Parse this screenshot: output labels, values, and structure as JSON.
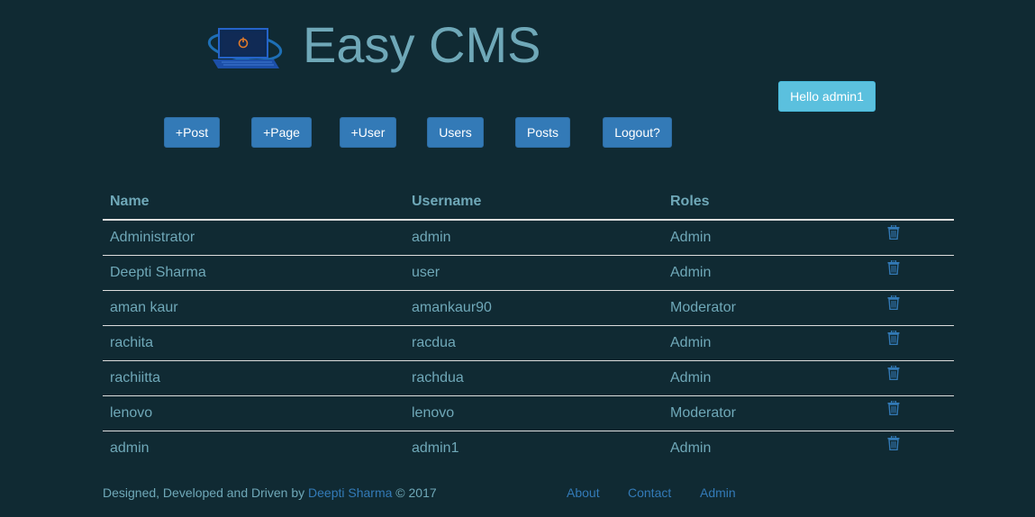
{
  "header": {
    "logo_icon": "laptop-power-icon",
    "title": "Easy CMS",
    "greeting": "Hello admin1"
  },
  "nav": {
    "post": "+Post",
    "page": "+Page",
    "user": "+User",
    "users": "Users",
    "posts": "Posts",
    "logout": "Logout?"
  },
  "table": {
    "headers": [
      "Name",
      "Username",
      "Roles"
    ],
    "rows": [
      {
        "name": "Administrator",
        "username": "admin",
        "role": "Admin"
      },
      {
        "name": "Deepti Sharma",
        "username": "user",
        "role": "Admin"
      },
      {
        "name": "aman kaur",
        "username": "amankaur90",
        "role": "Moderator"
      },
      {
        "name": "rachita",
        "username": "racdua",
        "role": "Admin"
      },
      {
        "name": "rachiitta",
        "username": "rachdua",
        "role": "Admin"
      },
      {
        "name": "lenovo",
        "username": "lenovo",
        "role": "Moderator"
      },
      {
        "name": "admin",
        "username": "admin1",
        "role": "Admin"
      }
    ],
    "delete_icon": "trash-icon"
  },
  "footer": {
    "prefix": "Designed, Developed and Driven by ",
    "author": "Deepti Sharma",
    "suffix": " © 2017",
    "links": [
      "About",
      "Contact",
      "Admin"
    ]
  },
  "colors": {
    "background": "#102a33",
    "text": "#6fa8b8",
    "primary": "#337ab7",
    "info": "#5bc0de"
  }
}
